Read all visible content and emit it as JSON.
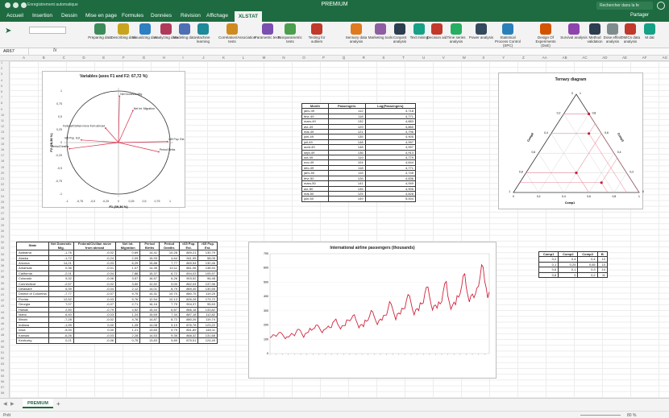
{
  "window": {
    "title": "PREMIUM",
    "quick_access": "Enregistrement automatique",
    "search_placeholder": "Rechercher dans la fe"
  },
  "ribbon_tabs": [
    "Accueil",
    "Insertion",
    "Dessin",
    "Mise en page",
    "Formules",
    "Données",
    "Révision",
    "Affichage",
    "XLSTAT"
  ],
  "share_label": "Partager",
  "ribbon_buttons": [
    {
      "label": "Preparing data",
      "color": "#3c8c5a"
    },
    {
      "label": "Describing data",
      "color": "#c8a41e"
    },
    {
      "label": "Visualizing data",
      "color": "#2d7fc1"
    },
    {
      "label": "Analyzing data",
      "color": "#b03a5b"
    },
    {
      "label": "Modeling data",
      "color": "#4f6fb5"
    },
    {
      "label": "Machine learning",
      "color": "#1e8a9a"
    },
    {
      "label": "Correlation/Association tests",
      "color": "#d08b20"
    },
    {
      "label": "Parametric tests",
      "color": "#7a4fb0"
    },
    {
      "label": "Nonparametric tests",
      "color": "#4a9e4e"
    },
    {
      "label": "Testing for outliers",
      "color": "#c0392b"
    },
    {
      "label": "Sensory data analysis",
      "color": "#e07a20"
    },
    {
      "label": "Marketing tools",
      "color": "#8e5ea2"
    },
    {
      "label": "Conjoint analysis",
      "color": "#2c3e50"
    },
    {
      "label": "Text mining",
      "color": "#16a085"
    },
    {
      "label": "Decision aid",
      "color": "#c0392b"
    },
    {
      "label": "Time series analysis",
      "color": "#27ae60"
    },
    {
      "label": "Power analysis",
      "color": "#34495e"
    },
    {
      "label": "Statistical Process Control (SPC)",
      "color": "#2980b9"
    },
    {
      "label": "Design Of Experiments (DoE)",
      "color": "#d35400"
    },
    {
      "label": "Survival analysis",
      "color": "#8e44ad"
    },
    {
      "label": "Method validation",
      "color": "#2c3e50"
    },
    {
      "label": "Dose effect analysis",
      "color": "#7f8c8d"
    },
    {
      "label": "OMICs data analysis",
      "color": "#c0392b"
    },
    {
      "label": "M dat",
      "color": "#16a085"
    }
  ],
  "formula_bar": {
    "name_box": "AR67",
    "fx": "fx"
  },
  "columns": [
    "A",
    "B",
    "C",
    "D",
    "E",
    "F",
    "G",
    "H",
    "I",
    "J",
    "K",
    "L",
    "M",
    "N",
    "O",
    "P",
    "Q",
    "R",
    "S",
    "T",
    "U",
    "V",
    "W",
    "X",
    "Y",
    "Z",
    "AA",
    "AB",
    "AC",
    "AD",
    "AE",
    "AF",
    "AG"
  ],
  "pca": {
    "title": "Variables (axes F1 and F2: 67,72 %)",
    "xlabel": "F1 (39,36 %)",
    "ylabel": "F2 (28,36 %)",
    "xticks": [
      "-1",
      "-0,75",
      "-0,5",
      "-0,25",
      "0",
      "0,25",
      "0,5",
      "0,75",
      "1"
    ],
    "yticks": [
      "1",
      "0,75",
      "0,5",
      "0,25",
      "0",
      "-0,25",
      "-0,5",
      "-0,75",
      "-1"
    ],
    "vectors": [
      {
        "label": "Net Domestic Mig.",
        "x": 0.02,
        "y": 0.9
      },
      {
        "label": "Net Int. Migration",
        "x": 0.28,
        "y": 0.62
      },
      {
        "label": "Federal/Civilian move from abroad",
        "x": -0.25,
        "y": 0.28
      },
      {
        "label": ">65 Pop. Est.",
        "x": -0.72,
        "y": 0.05
      },
      {
        "label": "Period Deaths",
        "x": -0.95,
        "y": -0.12
      },
      {
        "label": "<65 Pop. Est.",
        "x": 0.95,
        "y": 0.02
      },
      {
        "label": "Period Births",
        "x": 0.78,
        "y": -0.18
      }
    ]
  },
  "passengers_table": {
    "headers": [
      "Month",
      "Passengers",
      "Log(Passengers)"
    ],
    "rows": [
      [
        "janv-49",
        "112",
        "4,718"
      ],
      [
        "févr-49",
        "118",
        "4,771"
      ],
      [
        "mars-49",
        "132",
        "4,883"
      ],
      [
        "avr-49",
        "129",
        "4,860"
      ],
      [
        "mai-49",
        "121",
        "4,796"
      ],
      [
        "juin-49",
        "135",
        "4,905"
      ],
      [
        "juil-49",
        "148",
        "4,997"
      ],
      [
        "août-49",
        "148",
        "4,997"
      ],
      [
        "sept-49",
        "136",
        "4,913"
      ],
      [
        "oct-49",
        "119",
        "4,779"
      ],
      [
        "nov-49",
        "104",
        "4,644"
      ],
      [
        "déc-49",
        "118",
        "4,771"
      ],
      [
        "janv-50",
        "115",
        "4,745"
      ],
      [
        "févr-50",
        "126",
        "4,836"
      ],
      [
        "mars-50",
        "141",
        "4,949"
      ],
      [
        "avr-50",
        "135",
        "4,905"
      ],
      [
        "mai-50",
        "125",
        "4,828"
      ],
      [
        "juin-50",
        "149",
        "5,004"
      ]
    ]
  },
  "ternary": {
    "title": "Ternary diagram",
    "axis_labels": [
      "Comp1",
      "Comp2",
      "Comp3"
    ],
    "ticks": [
      "0",
      "0,2",
      "0,4",
      "0,6",
      "0,8",
      "1"
    ],
    "points": [
      [
        0.2,
        0.4,
        0.4
      ],
      [
        0.1,
        0.25,
        0.65
      ],
      [
        0.6,
        0.1,
        0.3
      ],
      [
        0.8,
        0,
        0.2
      ]
    ]
  },
  "comp_table": {
    "headers": [
      "Comp1",
      "Comp2",
      "Comp3",
      "B"
    ],
    "rows": [
      [
        "0,2",
        "0,4",
        "0,4",
        "12"
      ],
      [
        "0,1",
        "0,25",
        "0,65",
        "10"
      ],
      [
        "0,6",
        "0,1",
        "0,3",
        "14"
      ],
      [
        "0,8",
        "0",
        "0,2",
        "11"
      ]
    ]
  },
  "states_table": {
    "headers": [
      "State",
      "Net Domestic Mig.",
      "Federal/Civilian move from abroad",
      "Net Int. Migration",
      "Period Births",
      "Period Deaths",
      "<65 Pop. Est.",
      ">65 Pop. Est."
    ],
    "rows": [
      [
        "Alabama",
        "-1,76",
        "-0,02",
        "0,69",
        "14,41",
        "10,28",
        "869,21",
        "130,79"
      ],
      [
        "Alaska",
        "-1,72",
        "-0,24",
        "2,09",
        "15,93",
        "4,64",
        "941,95",
        "58,05"
      ],
      [
        "Arizona",
        "14,21",
        "-0,03",
        "6,29",
        "15,88",
        "7,77",
        "869,54",
        "130,46"
      ],
      [
        "Arkansas",
        "0,36",
        "-0,01",
        "1,07",
        "14,35",
        "10,11",
        "861,06",
        "138,94"
      ],
      [
        "California",
        "-2,01",
        "-0,04",
        "7,88",
        "15,37",
        "6,72",
        "894,03",
        "105,97"
      ],
      [
        "Colorado",
        "9,32",
        "-0,06",
        "3,57",
        "16,57",
        "6,26",
        "903,52",
        "96,48"
      ],
      [
        "Connecticut",
        "-2,57",
        "-0,02",
        "3,50",
        "12,52",
        "9,00",
        "862,04",
        "137,96"
      ],
      [
        "Delaware",
        "5,39",
        "-0,04",
        "2,12",
        "14,01",
        "8,79",
        "869,45",
        "130,55"
      ],
      [
        "District of Columbia",
        "-7,77",
        "-0,07",
        "9,75",
        "14,31",
        "10,70",
        "880,75",
        "119,25"
      ],
      [
        "Florida",
        "12,52",
        "-0,03",
        "5,76",
        "12,54",
        "10,13",
        "826,28",
        "173,72"
      ],
      [
        "Georgia",
        "7,07",
        "-0,07",
        "2,71",
        "16,16",
        "7,79",
        "904,37",
        "95,63"
      ],
      [
        "Hawaii",
        "2,50",
        "-0,79",
        "4,52",
        "15,44",
        "6,87",
        "866,18",
        "133,82"
      ],
      [
        "Idaho",
        "6,40",
        "-0,03",
        "1,24",
        "15,69",
        "7,34",
        "887,18",
        "112,82"
      ],
      [
        "Illinois",
        "-7,28",
        "-0,02",
        "4,76",
        "14,87",
        "8,72",
        "880,26",
        "119,74"
      ],
      [
        "Indiana",
        "-1,99",
        "0,00",
        "1,25",
        "14,08",
        "9,19",
        "876,78",
        "123,22"
      ],
      [
        "Iowa",
        "-5,00",
        "0,00",
        "1,21",
        "13,83",
        "9,79",
        "851,89",
        "148,11"
      ],
      [
        "Kansas",
        "-6,26",
        "-0,03",
        "2,28",
        "14,53",
        "9,35",
        "868,32",
        "131,68"
      ],
      [
        "Kentucky",
        "0,21",
        "-0,06",
        "0,75",
        "13,83",
        "9,89",
        "875,51",
        "124,49"
      ]
    ]
  },
  "airline": {
    "title": "International airline passengers (thousands)",
    "yticks": [
      "0",
      "100",
      "200",
      "300",
      "400",
      "500",
      "600",
      "700"
    ],
    "values": [
      112,
      118,
      132,
      129,
      121,
      135,
      148,
      148,
      136,
      119,
      104,
      118,
      115,
      126,
      141,
      135,
      125,
      149,
      170,
      170,
      158,
      133,
      114,
      140,
      145,
      150,
      178,
      163,
      172,
      178,
      199,
      199,
      184,
      162,
      146,
      166,
      171,
      180,
      193,
      181,
      183,
      218,
      230,
      242,
      209,
      191,
      172,
      194,
      196,
      196,
      236,
      235,
      229,
      243,
      264,
      272,
      237,
      211,
      180,
      201,
      204,
      188,
      235,
      227,
      234,
      264,
      302,
      293,
      259,
      229,
      203,
      229,
      242,
      233,
      267,
      269,
      270,
      315,
      364,
      347,
      312,
      274,
      237,
      278,
      284,
      277,
      317,
      313,
      318,
      374,
      413,
      405,
      355,
      306,
      271,
      306,
      315,
      301,
      356,
      348,
      355,
      422,
      465,
      467,
      404,
      347,
      305,
      336,
      340,
      318,
      362,
      348,
      363,
      435,
      491,
      505,
      404,
      359,
      310,
      337,
      360,
      342,
      406,
      396,
      420,
      472,
      548,
      559,
      463,
      407,
      362,
      405,
      417,
      391,
      419,
      461,
      472,
      535,
      622,
      606,
      508,
      461,
      390,
      432
    ]
  },
  "sheet_tab": "PREMIUM",
  "add_sheet": "+",
  "status": {
    "left": "Prêt",
    "zoom": "80 %"
  }
}
